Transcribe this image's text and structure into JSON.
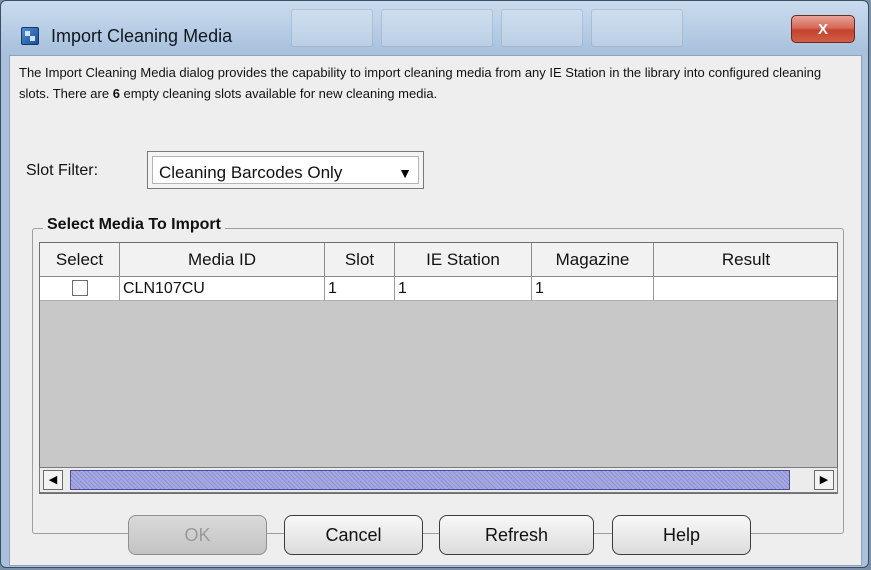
{
  "window": {
    "title": "Import Cleaning Media",
    "close_glyph": "X"
  },
  "description": {
    "part1": "The Import Cleaning Media dialog provides the capability to import cleaning media from any IE Station in the library into configured cleaning slots. There are ",
    "empty_slots": "6",
    "part2": " empty cleaning slots available for new cleaning media."
  },
  "slot_filter": {
    "label": "Slot Filter:",
    "value": "Cleaning Barcodes Only"
  },
  "media_group": {
    "title": "Select Media To Import",
    "columns": [
      "Select",
      "Media ID",
      "Slot",
      "IE Station",
      "Magazine",
      "Result"
    ],
    "rows": [
      {
        "select": false,
        "media_id": "CLN107CU",
        "slot": "1",
        "ie_station": "1",
        "magazine": "1",
        "result": ""
      }
    ]
  },
  "buttons": {
    "ok": "OK",
    "cancel": "Cancel",
    "refresh": "Refresh",
    "help": "Help"
  },
  "icons": {
    "app": "app-window-icon",
    "close": "close-icon",
    "filter_dropdown": "triangle-down-icon",
    "scroll_left": "triangle-left-icon",
    "scroll_right": "triangle-right-icon"
  }
}
